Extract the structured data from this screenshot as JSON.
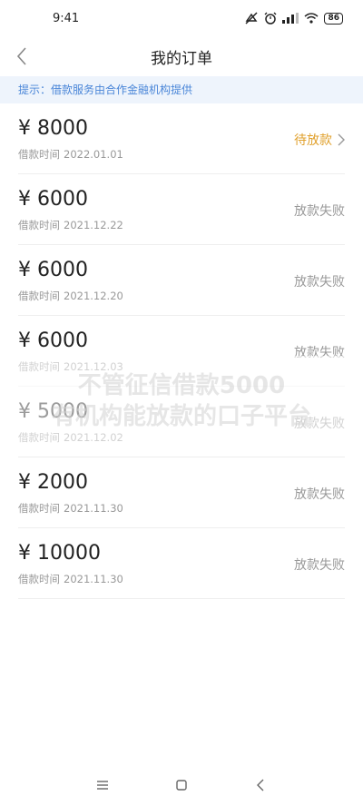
{
  "status_bar": {
    "time": "9:41",
    "battery": "86",
    "icons": [
      "mute-icon",
      "alarm-icon",
      "signal-icon",
      "wifi-icon",
      "battery-icon"
    ]
  },
  "header": {
    "title": "我的订单",
    "back_icon": "chevron-left-icon"
  },
  "notice": {
    "text": "提示：借款服务由合作金融机构提供"
  },
  "orders": [
    {
      "amount": "¥ 8000",
      "time_label": "借款时间",
      "time": "2022.01.01",
      "status": "待放款",
      "status_color": "#e0a02c"
    },
    {
      "amount": "¥ 6000",
      "time_label": "借款时间",
      "time": "2021.12.22",
      "status": "放款失败",
      "status_color": "#999999"
    },
    {
      "amount": "¥ 6000",
      "time_label": "借款时间",
      "time": "2021.12.20",
      "status": "放款失败",
      "status_color": "#999999"
    },
    {
      "amount": "¥ 6000",
      "time_label": "借款时间",
      "time": "2021.12.03",
      "status": "放款失败",
      "status_color": "#999999"
    },
    {
      "amount": "¥ 5000",
      "time_label": "借款时间",
      "time": "2021.12.02",
      "status": "放款失败",
      "status_color": "#999999"
    },
    {
      "amount": "¥ 2000",
      "time_label": "借款时间",
      "time": "2021.11.30",
      "status": "放款失败",
      "status_color": "#999999"
    },
    {
      "amount": "¥ 10000",
      "time_label": "借款时间",
      "time": "2021.11.30",
      "status": "放款失败",
      "status_color": "#999999"
    }
  ],
  "watermark": {
    "line1": "不管征信借款5000",
    "line2": "有机构能放款的口子平台"
  },
  "bottom_nav": {
    "icons": [
      "menu-icon",
      "home-icon",
      "back-icon"
    ]
  }
}
